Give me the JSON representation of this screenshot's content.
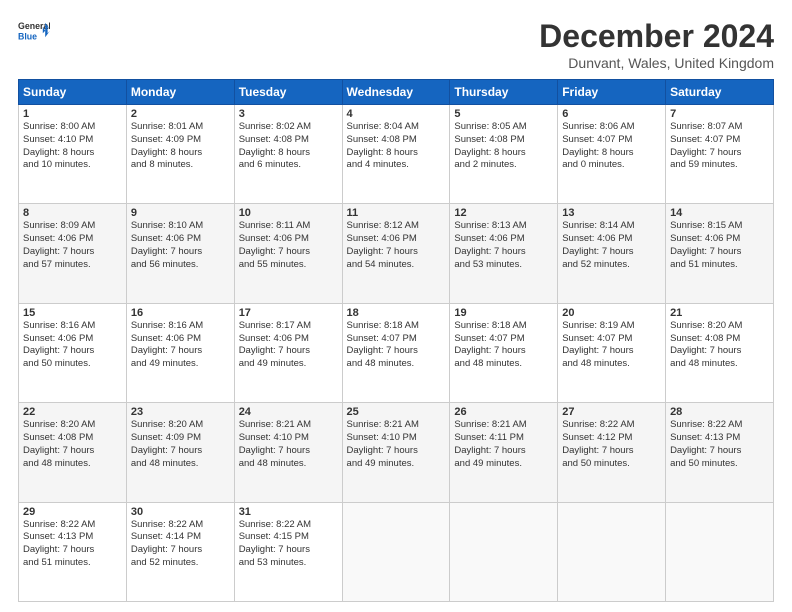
{
  "header": {
    "logo_line1": "General",
    "logo_line2": "Blue",
    "month_title": "December 2024",
    "location": "Dunvant, Wales, United Kingdom"
  },
  "weekdays": [
    "Sunday",
    "Monday",
    "Tuesday",
    "Wednesday",
    "Thursday",
    "Friday",
    "Saturday"
  ],
  "weeks": [
    [
      {
        "day": 1,
        "sunrise": "8:00 AM",
        "sunset": "4:10 PM",
        "daylight": "8 hours and 10 minutes."
      },
      {
        "day": 2,
        "sunrise": "8:01 AM",
        "sunset": "4:09 PM",
        "daylight": "8 hours and 8 minutes."
      },
      {
        "day": 3,
        "sunrise": "8:02 AM",
        "sunset": "4:08 PM",
        "daylight": "8 hours and 6 minutes."
      },
      {
        "day": 4,
        "sunrise": "8:04 AM",
        "sunset": "4:08 PM",
        "daylight": "8 hours and 4 minutes."
      },
      {
        "day": 5,
        "sunrise": "8:05 AM",
        "sunset": "4:08 PM",
        "daylight": "8 hours and 2 minutes."
      },
      {
        "day": 6,
        "sunrise": "8:06 AM",
        "sunset": "4:07 PM",
        "daylight": "8 hours and 0 minutes."
      },
      {
        "day": 7,
        "sunrise": "8:07 AM",
        "sunset": "4:07 PM",
        "daylight": "7 hours and 59 minutes."
      }
    ],
    [
      {
        "day": 8,
        "sunrise": "8:09 AM",
        "sunset": "4:06 PM",
        "daylight": "7 hours and 57 minutes."
      },
      {
        "day": 9,
        "sunrise": "8:10 AM",
        "sunset": "4:06 PM",
        "daylight": "7 hours and 56 minutes."
      },
      {
        "day": 10,
        "sunrise": "8:11 AM",
        "sunset": "4:06 PM",
        "daylight": "7 hours and 55 minutes."
      },
      {
        "day": 11,
        "sunrise": "8:12 AM",
        "sunset": "4:06 PM",
        "daylight": "7 hours and 54 minutes."
      },
      {
        "day": 12,
        "sunrise": "8:13 AM",
        "sunset": "4:06 PM",
        "daylight": "7 hours and 53 minutes."
      },
      {
        "day": 13,
        "sunrise": "8:14 AM",
        "sunset": "4:06 PM",
        "daylight": "7 hours and 52 minutes."
      },
      {
        "day": 14,
        "sunrise": "8:15 AM",
        "sunset": "4:06 PM",
        "daylight": "7 hours and 51 minutes."
      }
    ],
    [
      {
        "day": 15,
        "sunrise": "8:16 AM",
        "sunset": "4:06 PM",
        "daylight": "7 hours and 50 minutes."
      },
      {
        "day": 16,
        "sunrise": "8:16 AM",
        "sunset": "4:06 PM",
        "daylight": "7 hours and 49 minutes."
      },
      {
        "day": 17,
        "sunrise": "8:17 AM",
        "sunset": "4:06 PM",
        "daylight": "7 hours and 49 minutes."
      },
      {
        "day": 18,
        "sunrise": "8:18 AM",
        "sunset": "4:07 PM",
        "daylight": "7 hours and 48 minutes."
      },
      {
        "day": 19,
        "sunrise": "8:18 AM",
        "sunset": "4:07 PM",
        "daylight": "7 hours and 48 minutes."
      },
      {
        "day": 20,
        "sunrise": "8:19 AM",
        "sunset": "4:07 PM",
        "daylight": "7 hours and 48 minutes."
      },
      {
        "day": 21,
        "sunrise": "8:20 AM",
        "sunset": "4:08 PM",
        "daylight": "7 hours and 48 minutes."
      }
    ],
    [
      {
        "day": 22,
        "sunrise": "8:20 AM",
        "sunset": "4:08 PM",
        "daylight": "7 hours and 48 minutes."
      },
      {
        "day": 23,
        "sunrise": "8:20 AM",
        "sunset": "4:09 PM",
        "daylight": "7 hours and 48 minutes."
      },
      {
        "day": 24,
        "sunrise": "8:21 AM",
        "sunset": "4:10 PM",
        "daylight": "7 hours and 48 minutes."
      },
      {
        "day": 25,
        "sunrise": "8:21 AM",
        "sunset": "4:10 PM",
        "daylight": "7 hours and 49 minutes."
      },
      {
        "day": 26,
        "sunrise": "8:21 AM",
        "sunset": "4:11 PM",
        "daylight": "7 hours and 49 minutes."
      },
      {
        "day": 27,
        "sunrise": "8:22 AM",
        "sunset": "4:12 PM",
        "daylight": "7 hours and 50 minutes."
      },
      {
        "day": 28,
        "sunrise": "8:22 AM",
        "sunset": "4:13 PM",
        "daylight": "7 hours and 50 minutes."
      }
    ],
    [
      {
        "day": 29,
        "sunrise": "8:22 AM",
        "sunset": "4:13 PM",
        "daylight": "7 hours and 51 minutes."
      },
      {
        "day": 30,
        "sunrise": "8:22 AM",
        "sunset": "4:14 PM",
        "daylight": "7 hours and 52 minutes."
      },
      {
        "day": 31,
        "sunrise": "8:22 AM",
        "sunset": "4:15 PM",
        "daylight": "7 hours and 53 minutes."
      },
      null,
      null,
      null,
      null
    ]
  ]
}
